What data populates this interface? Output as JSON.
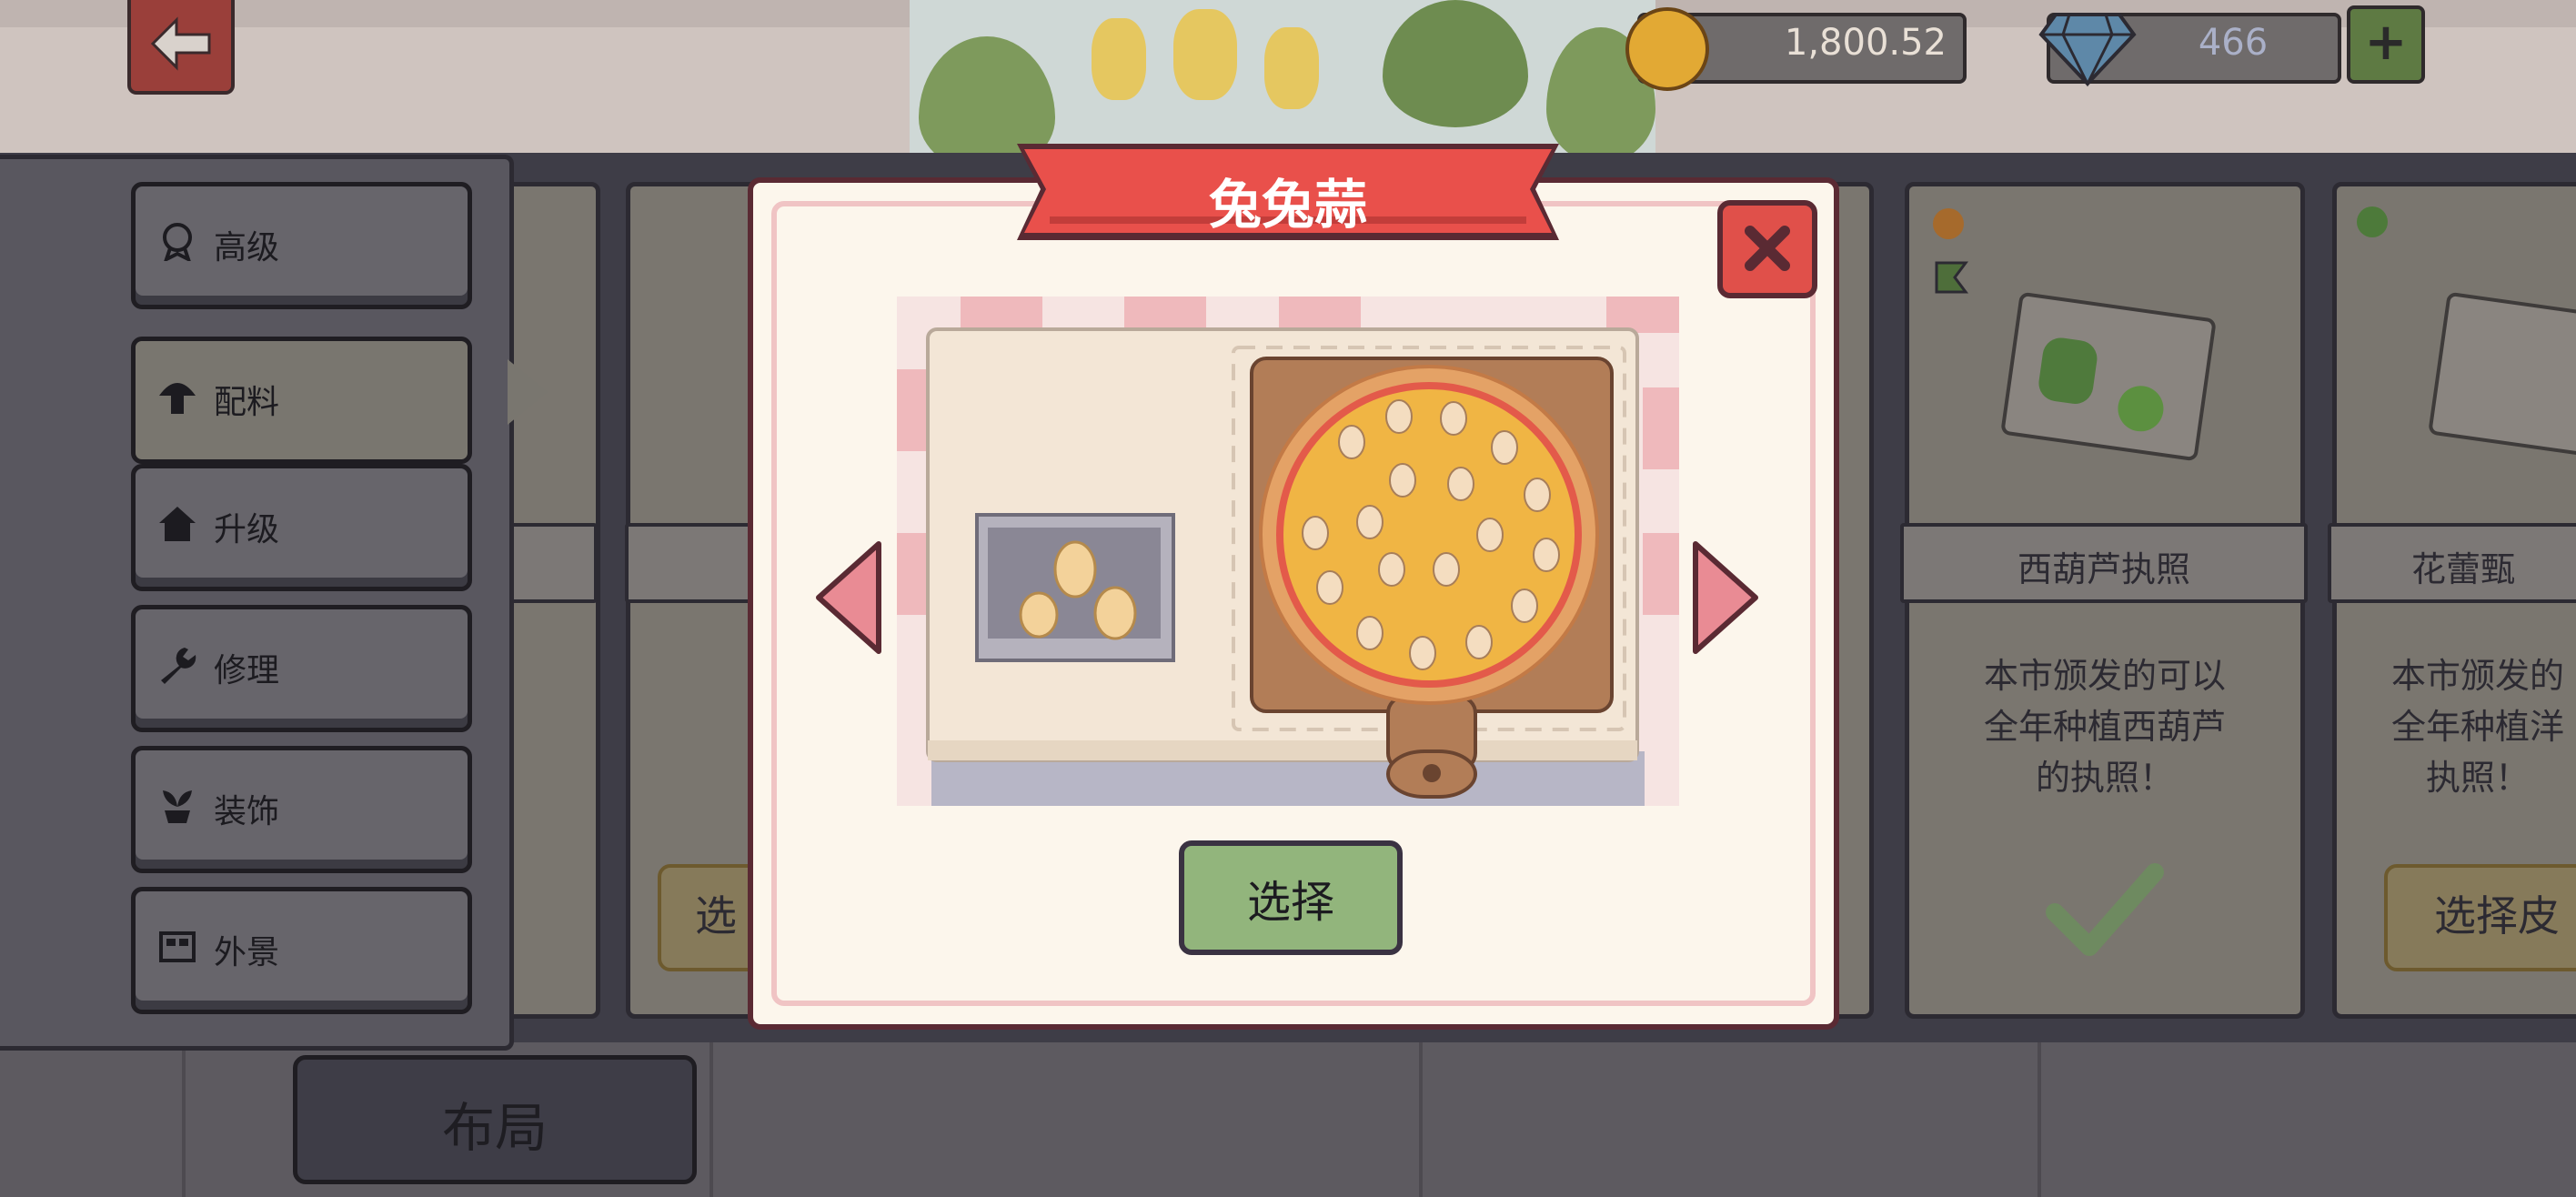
{
  "currency": {
    "coins": "1,800.52",
    "gems": "466",
    "plus_label": "+"
  },
  "sidebar": {
    "items": [
      {
        "label": "高级",
        "icon": "medal-icon"
      },
      {
        "label": "配料",
        "icon": "mushroom-icon"
      },
      {
        "label": "升级",
        "icon": "house-icon"
      },
      {
        "label": "修理",
        "icon": "wrench-icon"
      },
      {
        "label": "装饰",
        "icon": "plant-icon"
      },
      {
        "label": "外景",
        "icon": "storefront-icon"
      }
    ],
    "active_index": 1
  },
  "layout_button": "布局",
  "cards": [
    {
      "title": "西葫芦执照",
      "desc": [
        "本市颁发的可以",
        "全年种植西葫芦",
        "的执照！"
      ],
      "status": "owned"
    },
    {
      "title": "花蕾甄",
      "desc": [
        "本市颁发的",
        "全年种植洋",
        "执照！"
      ],
      "button": "选择皮"
    }
  ],
  "partial_card_button": "选",
  "modal": {
    "title": "兔兔蒜",
    "select_label": "选择",
    "close_label": "✕"
  },
  "colors": {
    "modal_bg": "#fcf6ec",
    "ribbon": "#e9504b",
    "select_button": "#92b57c",
    "close_button": "#e0504a"
  }
}
